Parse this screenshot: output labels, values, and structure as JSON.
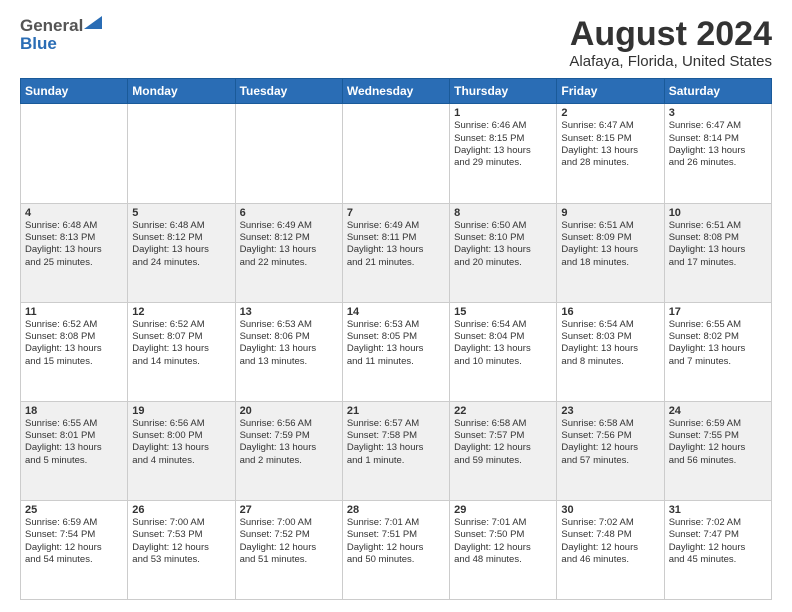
{
  "header": {
    "logo_general": "General",
    "logo_blue": "Blue",
    "title": "August 2024",
    "subtitle": "Alafaya, Florida, United States"
  },
  "weekdays": [
    "Sunday",
    "Monday",
    "Tuesday",
    "Wednesday",
    "Thursday",
    "Friday",
    "Saturday"
  ],
  "weeks": [
    [
      {
        "day": "",
        "text": ""
      },
      {
        "day": "",
        "text": ""
      },
      {
        "day": "",
        "text": ""
      },
      {
        "day": "",
        "text": ""
      },
      {
        "day": "1",
        "text": "Sunrise: 6:46 AM\nSunset: 8:15 PM\nDaylight: 13 hours\nand 29 minutes."
      },
      {
        "day": "2",
        "text": "Sunrise: 6:47 AM\nSunset: 8:15 PM\nDaylight: 13 hours\nand 28 minutes."
      },
      {
        "day": "3",
        "text": "Sunrise: 6:47 AM\nSunset: 8:14 PM\nDaylight: 13 hours\nand 26 minutes."
      }
    ],
    [
      {
        "day": "4",
        "text": "Sunrise: 6:48 AM\nSunset: 8:13 PM\nDaylight: 13 hours\nand 25 minutes."
      },
      {
        "day": "5",
        "text": "Sunrise: 6:48 AM\nSunset: 8:12 PM\nDaylight: 13 hours\nand 24 minutes."
      },
      {
        "day": "6",
        "text": "Sunrise: 6:49 AM\nSunset: 8:12 PM\nDaylight: 13 hours\nand 22 minutes."
      },
      {
        "day": "7",
        "text": "Sunrise: 6:49 AM\nSunset: 8:11 PM\nDaylight: 13 hours\nand 21 minutes."
      },
      {
        "day": "8",
        "text": "Sunrise: 6:50 AM\nSunset: 8:10 PM\nDaylight: 13 hours\nand 20 minutes."
      },
      {
        "day": "9",
        "text": "Sunrise: 6:51 AM\nSunset: 8:09 PM\nDaylight: 13 hours\nand 18 minutes."
      },
      {
        "day": "10",
        "text": "Sunrise: 6:51 AM\nSunset: 8:08 PM\nDaylight: 13 hours\nand 17 minutes."
      }
    ],
    [
      {
        "day": "11",
        "text": "Sunrise: 6:52 AM\nSunset: 8:08 PM\nDaylight: 13 hours\nand 15 minutes."
      },
      {
        "day": "12",
        "text": "Sunrise: 6:52 AM\nSunset: 8:07 PM\nDaylight: 13 hours\nand 14 minutes."
      },
      {
        "day": "13",
        "text": "Sunrise: 6:53 AM\nSunset: 8:06 PM\nDaylight: 13 hours\nand 13 minutes."
      },
      {
        "day": "14",
        "text": "Sunrise: 6:53 AM\nSunset: 8:05 PM\nDaylight: 13 hours\nand 11 minutes."
      },
      {
        "day": "15",
        "text": "Sunrise: 6:54 AM\nSunset: 8:04 PM\nDaylight: 13 hours\nand 10 minutes."
      },
      {
        "day": "16",
        "text": "Sunrise: 6:54 AM\nSunset: 8:03 PM\nDaylight: 13 hours\nand 8 minutes."
      },
      {
        "day": "17",
        "text": "Sunrise: 6:55 AM\nSunset: 8:02 PM\nDaylight: 13 hours\nand 7 minutes."
      }
    ],
    [
      {
        "day": "18",
        "text": "Sunrise: 6:55 AM\nSunset: 8:01 PM\nDaylight: 13 hours\nand 5 minutes."
      },
      {
        "day": "19",
        "text": "Sunrise: 6:56 AM\nSunset: 8:00 PM\nDaylight: 13 hours\nand 4 minutes."
      },
      {
        "day": "20",
        "text": "Sunrise: 6:56 AM\nSunset: 7:59 PM\nDaylight: 13 hours\nand 2 minutes."
      },
      {
        "day": "21",
        "text": "Sunrise: 6:57 AM\nSunset: 7:58 PM\nDaylight: 13 hours\nand 1 minute."
      },
      {
        "day": "22",
        "text": "Sunrise: 6:58 AM\nSunset: 7:57 PM\nDaylight: 12 hours\nand 59 minutes."
      },
      {
        "day": "23",
        "text": "Sunrise: 6:58 AM\nSunset: 7:56 PM\nDaylight: 12 hours\nand 57 minutes."
      },
      {
        "day": "24",
        "text": "Sunrise: 6:59 AM\nSunset: 7:55 PM\nDaylight: 12 hours\nand 56 minutes."
      }
    ],
    [
      {
        "day": "25",
        "text": "Sunrise: 6:59 AM\nSunset: 7:54 PM\nDaylight: 12 hours\nand 54 minutes."
      },
      {
        "day": "26",
        "text": "Sunrise: 7:00 AM\nSunset: 7:53 PM\nDaylight: 12 hours\nand 53 minutes."
      },
      {
        "day": "27",
        "text": "Sunrise: 7:00 AM\nSunset: 7:52 PM\nDaylight: 12 hours\nand 51 minutes."
      },
      {
        "day": "28",
        "text": "Sunrise: 7:01 AM\nSunset: 7:51 PM\nDaylight: 12 hours\nand 50 minutes."
      },
      {
        "day": "29",
        "text": "Sunrise: 7:01 AM\nSunset: 7:50 PM\nDaylight: 12 hours\nand 48 minutes."
      },
      {
        "day": "30",
        "text": "Sunrise: 7:02 AM\nSunset: 7:48 PM\nDaylight: 12 hours\nand 46 minutes."
      },
      {
        "day": "31",
        "text": "Sunrise: 7:02 AM\nSunset: 7:47 PM\nDaylight: 12 hours\nand 45 minutes."
      }
    ]
  ]
}
